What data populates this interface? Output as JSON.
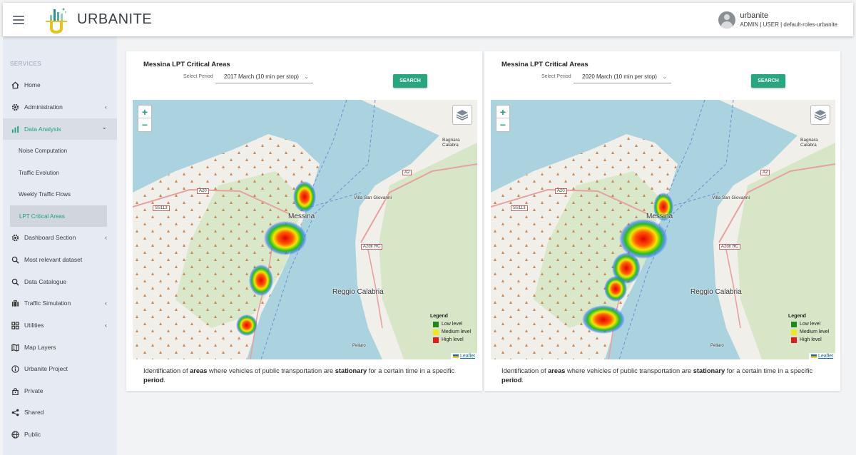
{
  "app": {
    "name": "URBANITE"
  },
  "user": {
    "name": "urbanite",
    "roles": "ADMIN | USER | default-roles-urbanite"
  },
  "sidebar": {
    "section_label": "SERVICES",
    "items": [
      {
        "label": "Home",
        "icon": "home-icon"
      },
      {
        "label": "Administration",
        "icon": "gear-icon",
        "chevron": "‹"
      },
      {
        "label": "Data Analysis",
        "icon": "bar-chart-icon",
        "chevron": "⌄"
      },
      {
        "label": "Noise Computation"
      },
      {
        "label": "Traffic Evolution"
      },
      {
        "label": "Weekly Traffic Flows"
      },
      {
        "label": "LPT Critical Areas"
      },
      {
        "label": "Dashboard Section",
        "icon": "gear-icon",
        "chevron": "‹"
      },
      {
        "label": "Most relevant dataset",
        "icon": "search-icon"
      },
      {
        "label": "Data Catalogue",
        "icon": "search-icon"
      },
      {
        "label": "Traffic Simulation",
        "icon": "briefcase-icon",
        "chevron": "‹"
      },
      {
        "label": "Utilities",
        "icon": "grid-icon",
        "chevron": "‹"
      },
      {
        "label": "Map Layers",
        "icon": "map-icon"
      },
      {
        "label": "Urbanite Project",
        "icon": "info-icon"
      },
      {
        "label": "Private",
        "icon": "lock-icon"
      },
      {
        "label": "Shared",
        "icon": "share-icon"
      },
      {
        "label": "Public",
        "icon": "globe-icon"
      }
    ]
  },
  "panels": [
    {
      "title": "Messina LPT Critical Areas",
      "period_label": "Select Period",
      "period_value": "2017 March (10 min per stop)",
      "search_label": "SEARCH",
      "map": {
        "zoom_in": "+",
        "zoom_out": "−",
        "legend": {
          "title": "Legend",
          "items": [
            {
              "label": "Low level",
              "color": "#1a8a1a"
            },
            {
              "label": "Medium level",
              "color": "#f2e61a"
            },
            {
              "label": "High level",
              "color": "#e61a1a"
            }
          ]
        },
        "attribution": "Leaflet",
        "place_labels": {
          "messina": "Messina",
          "villa": "Villa San Giovanni",
          "reggio": "Reggio Calabria",
          "bagnara": "Bagnara Calabra",
          "ss113": "SS113",
          "a20": "A20",
          "a2": "A2",
          "a2dir": "A2dir RC",
          "pellaro": "Pellaro"
        }
      },
      "description": {
        "p1": "Identification of ",
        "b1": "areas",
        "p2": " where vehicles of public transportation are ",
        "b2": "stationary",
        "p3": " for a certain time in a specific ",
        "b3": "period",
        "p4": "."
      }
    },
    {
      "title": "Messina LPT Critical Areas",
      "period_label": "Select Period",
      "period_value": "2020 March (10 min per stop)",
      "search_label": "SEARCH",
      "map": {
        "zoom_in": "+",
        "zoom_out": "−",
        "legend": {
          "title": "Legend",
          "items": [
            {
              "label": "Low level",
              "color": "#1a8a1a"
            },
            {
              "label": "Medium level",
              "color": "#f2e61a"
            },
            {
              "label": "High level",
              "color": "#e61a1a"
            }
          ]
        },
        "attribution": "Leaflet",
        "place_labels": {
          "messina": "Messina",
          "villa": "Villa San Giovanni",
          "reggio": "Reggio Calabria",
          "bagnara": "Bagnara Calabra",
          "ss113": "SS113",
          "a20": "A20",
          "a2": "A2",
          "a2dir": "A2dir RC",
          "pellaro": "Pellaro"
        }
      },
      "description": {
        "p1": "Identification of ",
        "b1": "areas",
        "p2": " where vehicles of public transportation are ",
        "b2": "stationary",
        "p3": " for a certain time in a specific ",
        "b3": "period",
        "p4": "."
      }
    }
  ],
  "colors": {
    "accent": "#26a77f",
    "sidebar_bg": "#e6eaf2",
    "sea": "#aad3df"
  }
}
